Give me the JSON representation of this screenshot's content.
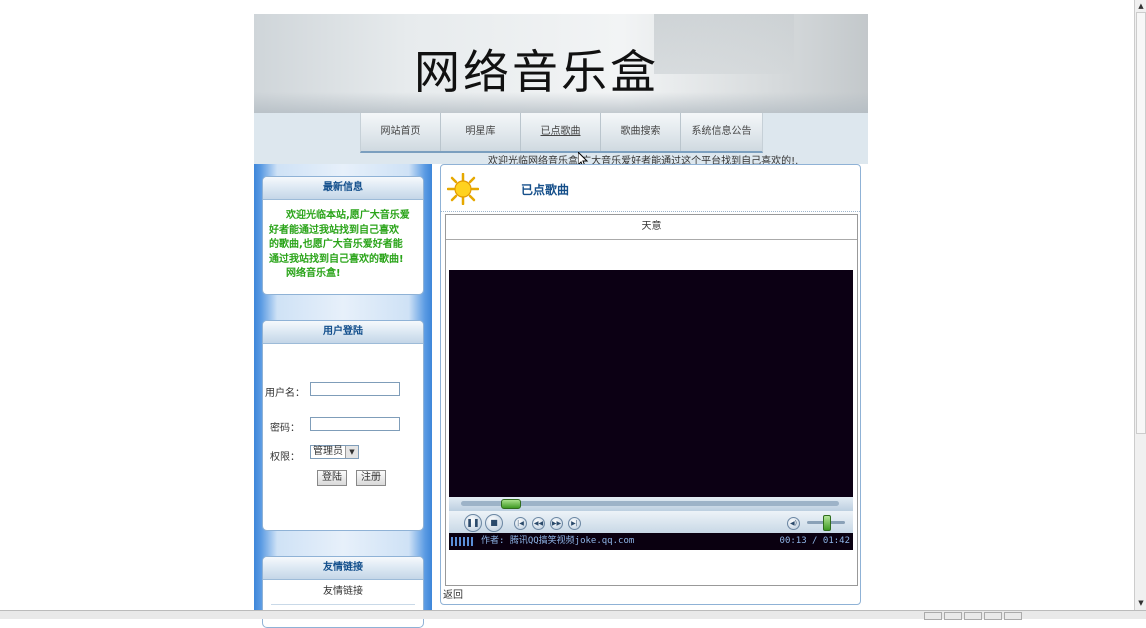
{
  "site": {
    "title": "网络音乐盒",
    "welcome": "欢迎光临网络音乐盒,广大音乐爱好者能通过这个平台找到自己喜欢的!."
  },
  "nav": {
    "items": [
      {
        "label": "网站首页"
      },
      {
        "label": "明星库"
      },
      {
        "label": "已点歌曲",
        "active": true
      },
      {
        "label": "歌曲搜索"
      },
      {
        "label": "系统信息公告"
      }
    ]
  },
  "sidebar": {
    "news": {
      "title": "最新信息",
      "line1": "欢迎光临本站,愿广大音乐爱",
      "line2": "好者能通过我站找到自己喜欢",
      "line3": "的歌曲,也愿广大音乐爱好者能",
      "line4": "通过我站找到自己喜欢的歌曲!",
      "line5": "网络音乐盒!"
    },
    "login": {
      "title": "用户登陆",
      "username_label": "用户名：",
      "username_value": "",
      "password_label": "密码：",
      "password_value": "",
      "role_label": "权限：",
      "role_selected": "管理员",
      "login_button": "登陆",
      "register_button": "注册"
    },
    "links": {
      "title": "友情链接",
      "item": "友情链接"
    }
  },
  "main": {
    "panel_title": "已点歌曲",
    "song_title": "天意",
    "player": {
      "author": "作者: 腾讯QQ搞笑视频joke.qq.com",
      "time": "00:13 / 01:42",
      "progress": 0.13
    },
    "back_link": "返回"
  },
  "icons": {
    "sun": "sun-icon",
    "play_pause": "pause-icon",
    "stop": "stop-icon",
    "prev": "previous-icon",
    "rewind": "rewind-icon",
    "fast_forward": "fast-forward-icon",
    "next": "next-icon",
    "volume": "speaker-icon"
  },
  "colors": {
    "sidebar_blue": "#3d86d9",
    "news_text": "#2aa419",
    "header_text": "#134f8c",
    "video_bg": "#0c0014"
  }
}
